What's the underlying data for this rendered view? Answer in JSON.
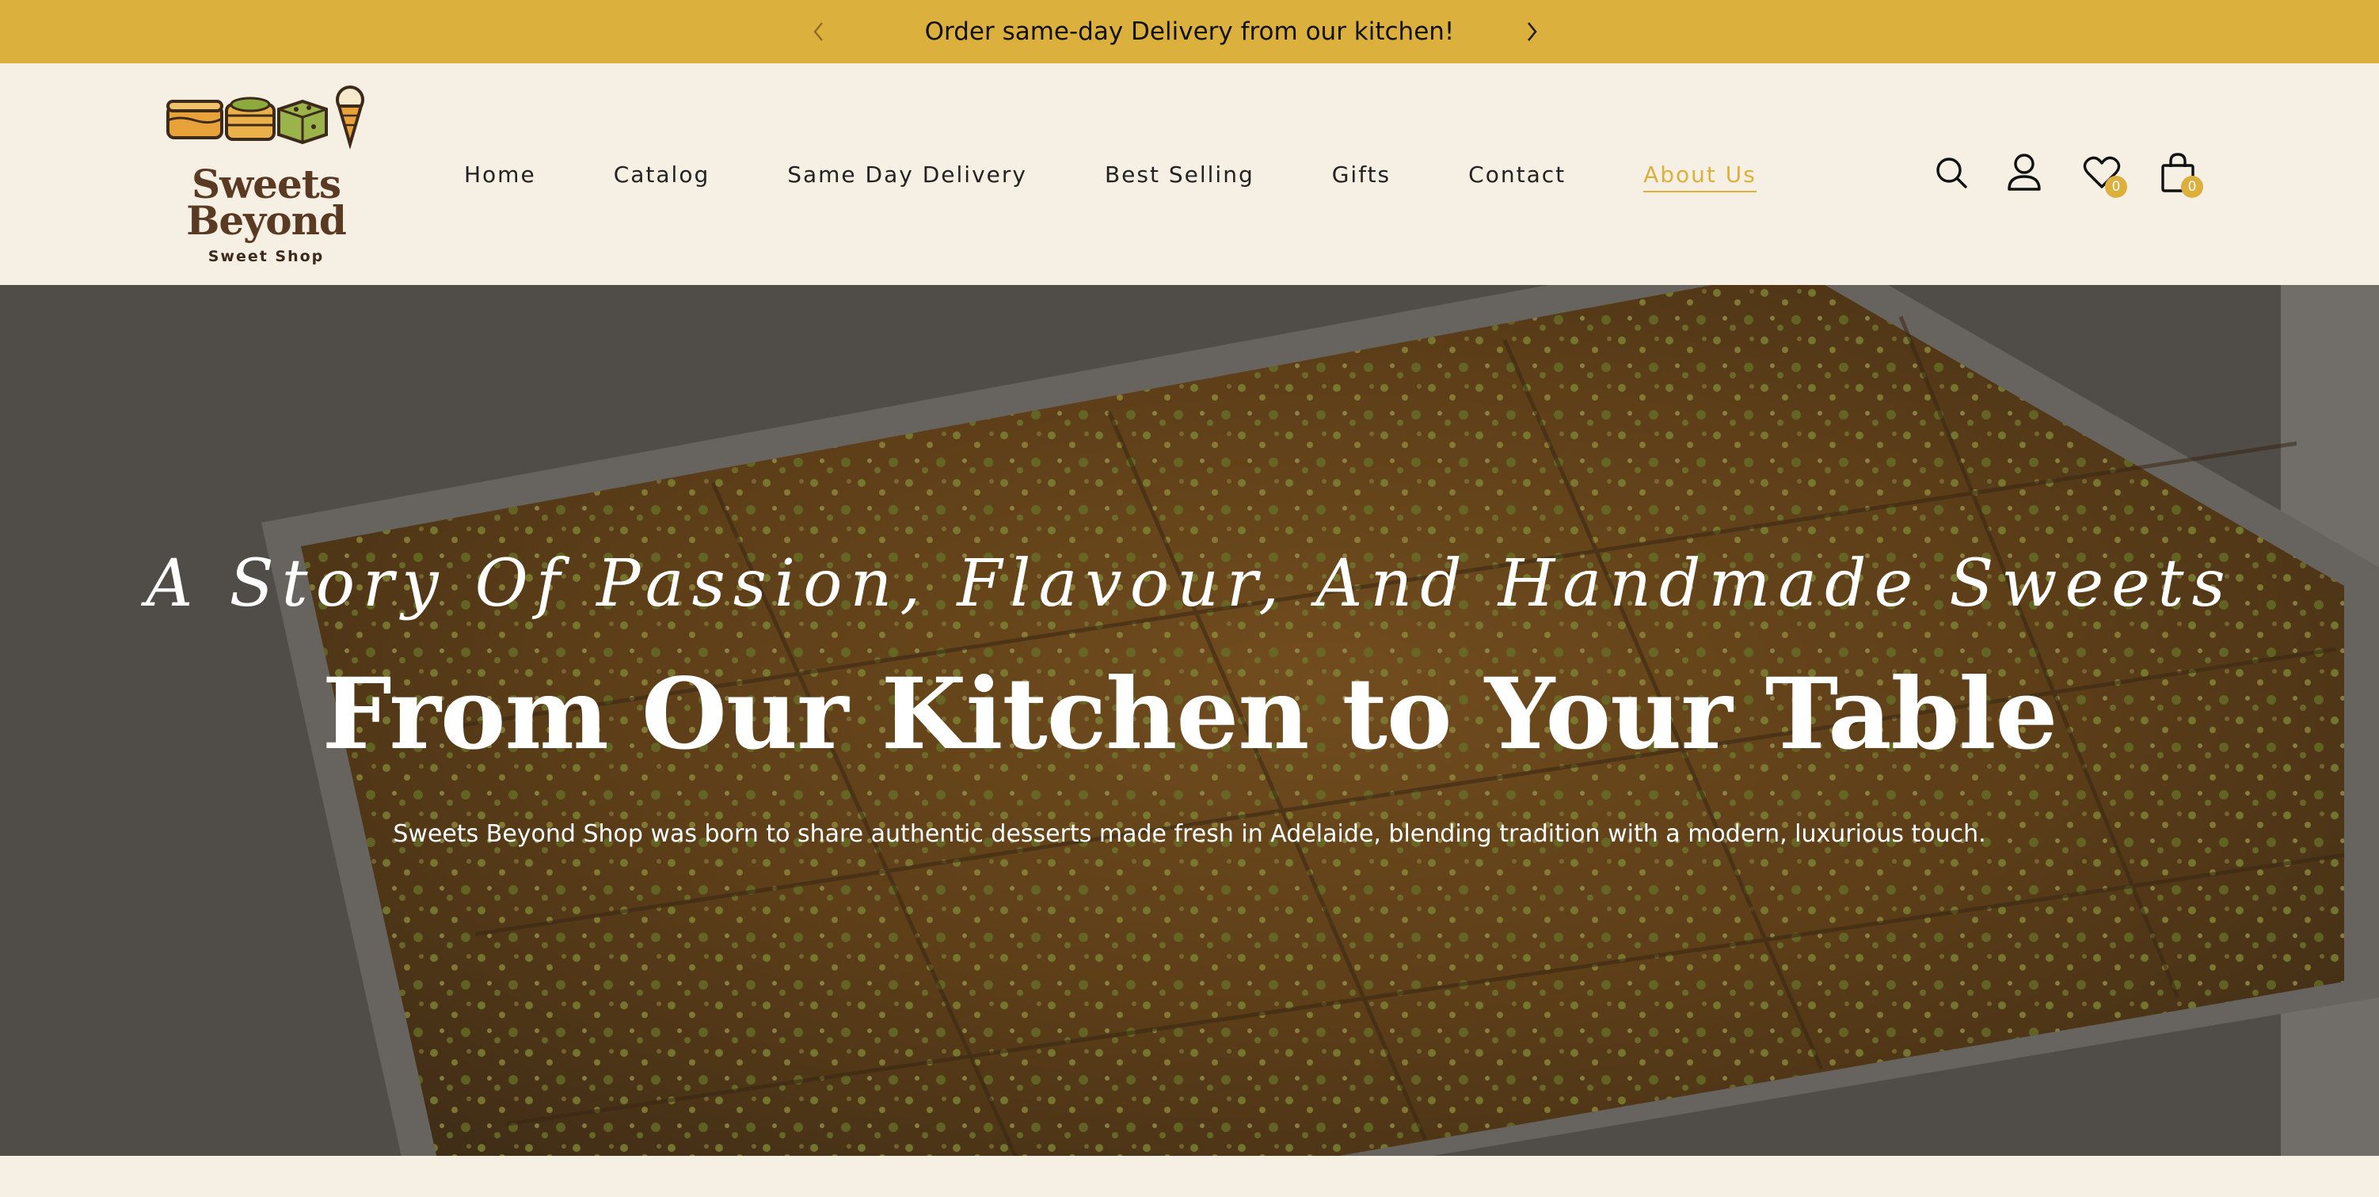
{
  "announcement": {
    "text": "Order same-day Delivery from our kitchen!",
    "prev_icon": "chevron-left-icon",
    "next_icon": "chevron-right-icon"
  },
  "logo": {
    "title_line1": "Sweets",
    "title_line2": "Beyond",
    "subtitle": "Sweet Shop"
  },
  "nav": {
    "items": [
      {
        "label": "Home"
      },
      {
        "label": "Catalog"
      },
      {
        "label": "Same Day Delivery"
      },
      {
        "label": "Best Selling"
      },
      {
        "label": "Gifts"
      },
      {
        "label": "Contact"
      },
      {
        "label": "About Us",
        "active": true
      }
    ]
  },
  "header_icons": {
    "search": "search-icon",
    "account": "account-icon",
    "wishlist": "heart-icon",
    "wishlist_count": "0",
    "cart": "shopping-bag-icon",
    "cart_count": "0"
  },
  "hero": {
    "script": "A Story Of Passion, Flavour, And Handmade Sweets",
    "title": "From Our Kitchen to Your Table",
    "description": "Sweets Beyond Shop was born to share authentic desserts made fresh in Adelaide, blending tradition with a modern, luxurious touch."
  },
  "colors": {
    "accent": "#dcb03c",
    "background": "#f6efe3",
    "logo_brown": "#5a3a22"
  }
}
